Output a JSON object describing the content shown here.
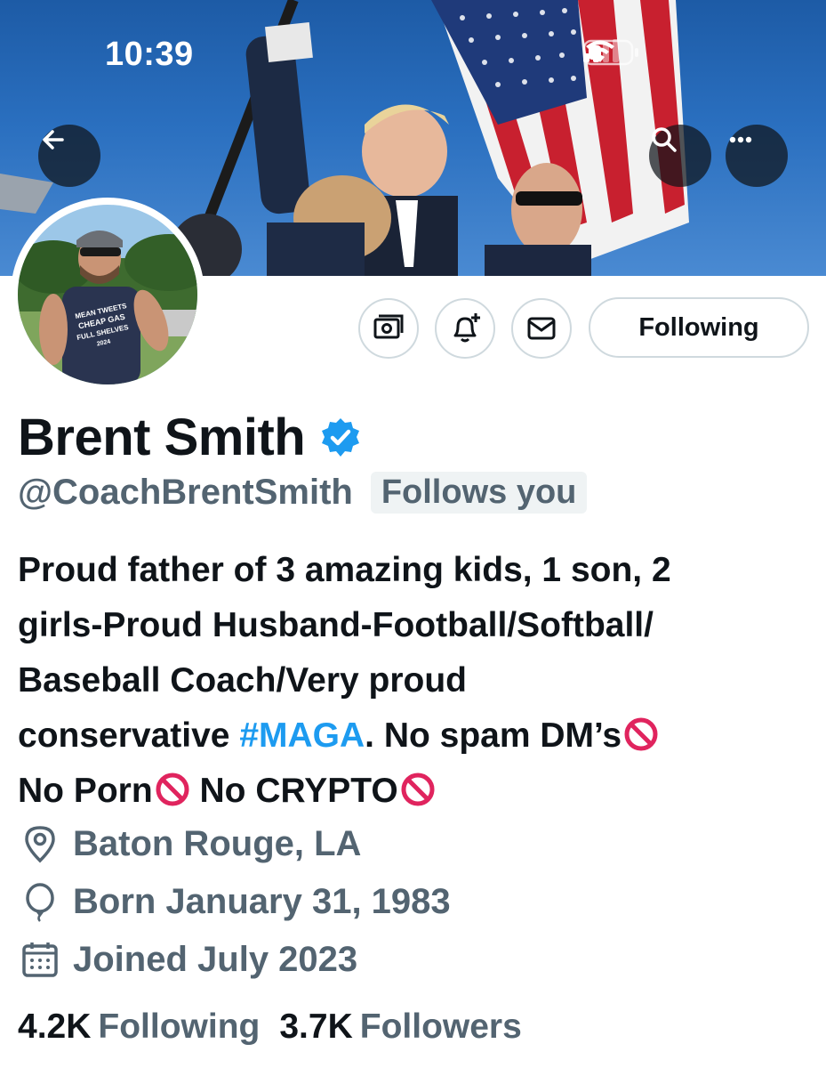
{
  "status_bar": {
    "time": "10:39"
  },
  "header": {
    "back_icon": "arrow-left-icon",
    "search_icon": "search-icon",
    "more_icon": "more-horizontal-icon"
  },
  "actions": {
    "tip_icon": "money-icon",
    "notify_icon": "bell-plus-icon",
    "message_icon": "envelope-icon",
    "following_label": "Following"
  },
  "profile": {
    "name": "Brent Smith",
    "verified": true,
    "handle": "@CoachBrentSmith",
    "follows_you": "Follows you",
    "avatar_shirt_lines": [
      "MEAN TWEETS",
      "CHEAP GAS",
      "FULL SHELVES",
      "2024"
    ],
    "bio": {
      "line1": "Proud father of 3 amazing kids, 1 son, 2",
      "line2": "girls-Proud Husband-Football/Softball/",
      "line3": "Baseball Coach/Very proud",
      "line4_pre": "conservative ",
      "line4_hashtag": "#MAGA",
      "line4_post": ". No spam DM’s",
      "line5_a": "No Porn",
      "line5_b": " No CRYPTO"
    },
    "location": "Baton Rouge, LA",
    "birthday": "Born January 31, 1983",
    "joined": "Joined July 2023",
    "following_count": "4.2K",
    "following_label": "Following",
    "followers_count": "3.7K",
    "followers_label": "Followers"
  },
  "colors": {
    "text": "#0f1419",
    "secondary": "#536471",
    "link": "#1d9bf0",
    "border": "#cfd9de",
    "badge_bg": "#eff3f4",
    "verified": "#1d9bf0",
    "prohibited": "#e0245e"
  }
}
